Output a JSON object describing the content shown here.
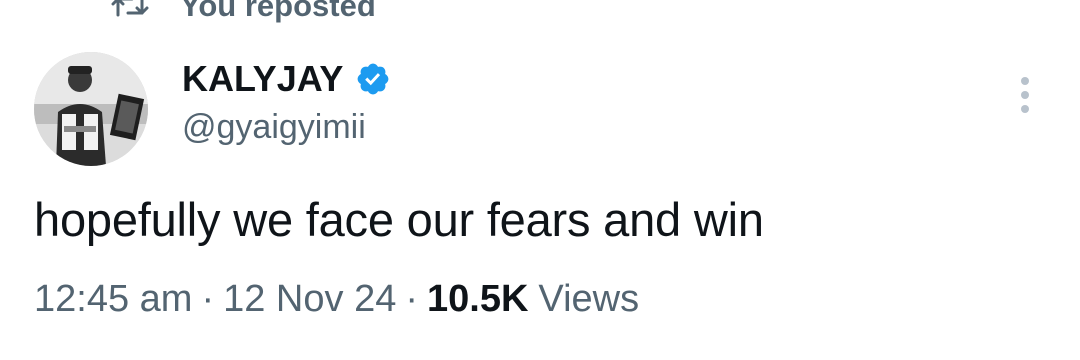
{
  "repost": {
    "label": "You reposted",
    "icon": "repost-icon"
  },
  "author": {
    "display_name": "KALYJAY",
    "handle": "@gyaigyimii",
    "verified": true,
    "verified_icon": "verified-badge-icon",
    "avatar": "avatar-photo"
  },
  "tweet": {
    "text": "hopefully we face our fears and win"
  },
  "meta": {
    "time": "12:45 am",
    "separator": "·",
    "date": "12 Nov 24",
    "views_count": "10.5K",
    "views_label": "Views"
  },
  "more_icon": "more-options-icon",
  "colors": {
    "text_primary": "#0f1419",
    "text_secondary": "#536471",
    "verified_blue": "#1d9bf0"
  }
}
